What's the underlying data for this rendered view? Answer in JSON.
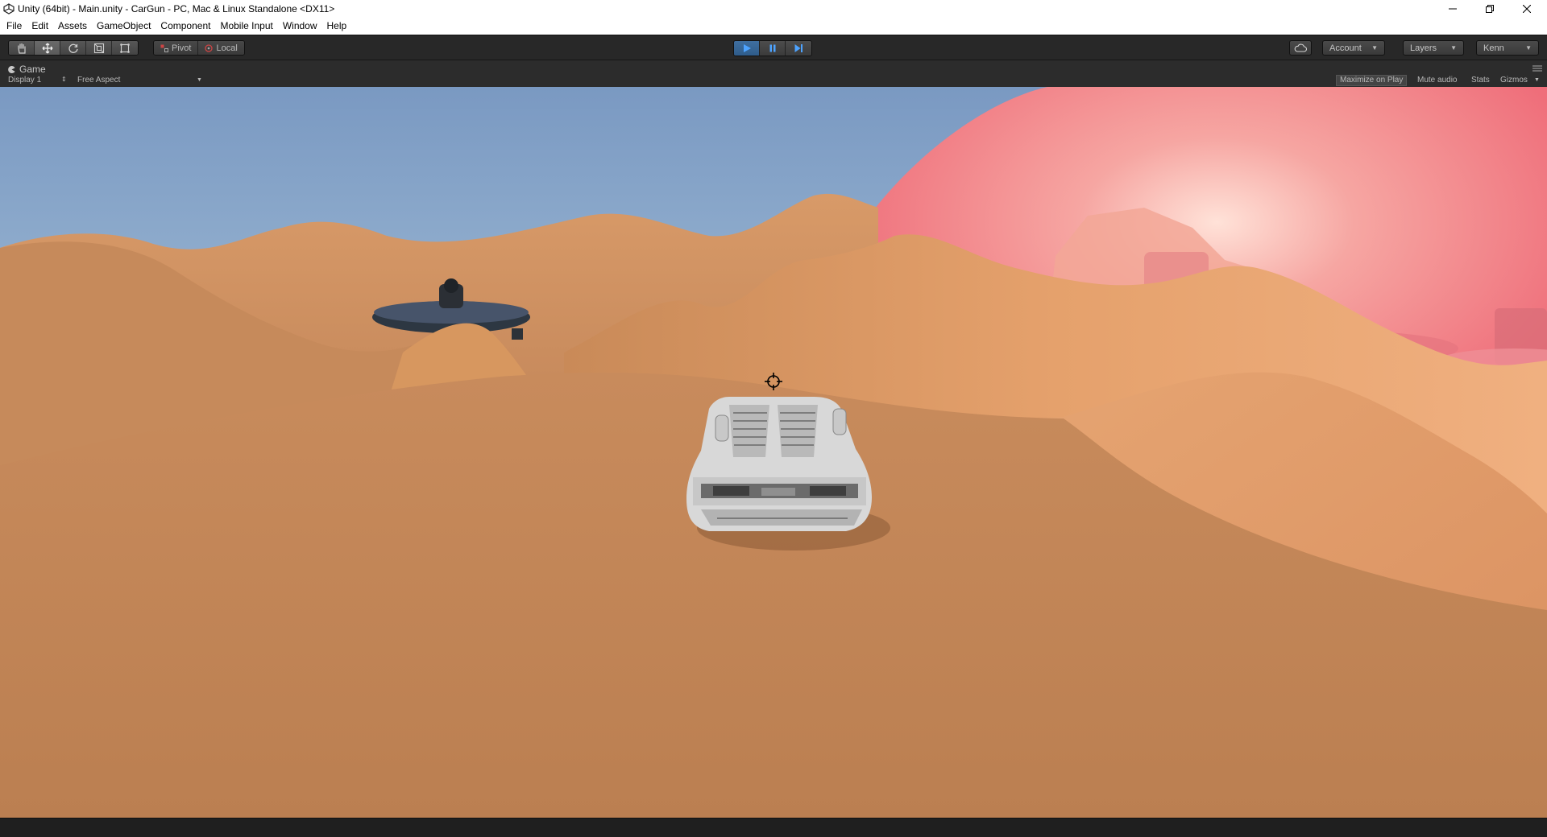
{
  "window": {
    "title": "Unity (64bit) - Main.unity - CarGun - PC, Mac & Linux Standalone <DX11>",
    "app_icon": "unity-logo-icon",
    "controls": [
      "minimize-icon",
      "restore-icon",
      "close-icon"
    ]
  },
  "menu": {
    "items": [
      "File",
      "Edit",
      "Assets",
      "GameObject",
      "Component",
      "Mobile Input",
      "Window",
      "Help"
    ]
  },
  "toolbar": {
    "transform_tools": [
      {
        "name": "hand-tool",
        "icon": "hand-icon"
      },
      {
        "name": "move-tool",
        "icon": "move-arrows-icon",
        "active": true
      },
      {
        "name": "rotate-tool",
        "icon": "rotate-icon"
      },
      {
        "name": "scale-tool",
        "icon": "scale-icon"
      },
      {
        "name": "rect-tool",
        "icon": "rect-icon"
      }
    ],
    "pivot_label": "Pivot",
    "local_label": "Local",
    "play_state": "playing",
    "account_label": "Account",
    "layers_label": "Layers",
    "layout_label": "Kenn",
    "cloud_icon": "cloud-icon"
  },
  "game_tab": {
    "title": "Game",
    "display": "Display 1",
    "aspect": "Free Aspect",
    "maximize_on_play": "Maximize on Play",
    "mute_audio": "Mute audio",
    "stats": "Stats",
    "gizmos": "Gizmos"
  },
  "scene": {
    "sky_top": "#7f9fc6",
    "sky_horizon": "#d9e6ea",
    "dune_color": "#c98c5c",
    "shield_color": "#f06a78",
    "car_color": "#d8d8d8",
    "reticle": "crosshair-icon"
  }
}
